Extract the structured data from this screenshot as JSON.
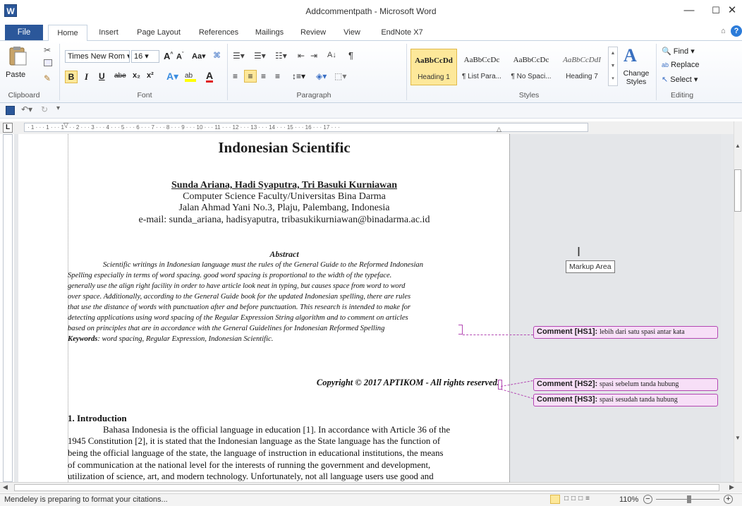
{
  "window": {
    "title": "Addcommentpath - Microsoft Word",
    "app_logo": "W",
    "minimize": "—",
    "maximize": "☐",
    "close": "✕"
  },
  "tabs": [
    {
      "label": "File"
    },
    {
      "label": "Home"
    },
    {
      "label": "Insert"
    },
    {
      "label": "Page Layout"
    },
    {
      "label": "References"
    },
    {
      "label": "Mailings"
    },
    {
      "label": "Review"
    },
    {
      "label": "View"
    },
    {
      "label": "EndNote X7"
    }
  ],
  "ribbon": {
    "clipboard": {
      "paste": "Paste",
      "label": "Clipboard"
    },
    "font": {
      "name": "Times New Rom",
      "size": "16",
      "label": "Font",
      "case": "Aa",
      "bold": "B",
      "italic": "I",
      "underline": "U",
      "strike": "abe",
      "sub": "x₂",
      "sup": "x²"
    },
    "paragraph": {
      "label": "Paragraph",
      "sort": "A↓",
      "pilcrow": "¶"
    },
    "styles": {
      "label": "Styles",
      "items": [
        {
          "preview": "AaBbCcDd",
          "name": "Heading 1"
        },
        {
          "preview": "AaBbCcDc",
          "name": "¶ List Para..."
        },
        {
          "preview": "AaBbCcDc",
          "name": "¶ No Spaci..."
        },
        {
          "preview": "AaBbCcDdI",
          "name": "Heading 7"
        }
      ],
      "change_styles": "Change Styles"
    },
    "editing": {
      "find": "Find",
      "replace": "Replace",
      "select": "Select",
      "label": "Editing"
    }
  },
  "ruler": {
    "marks": "· 1 · · · 1 · · · 1 · · · 2 · · · 3 · · · 4 · · · 5 · · · 6 · · · 7 · · · 8 · · · 9 · · · 10 · · · 11 · · · 12 · · · 13 · · · 14 · · · 15 · · · 16 · · · 17 · · ·"
  },
  "document": {
    "title": "Indonesian Scientific",
    "authors": "Sunda Ariana, Hadi Syaputra, Tri Basuki Kurniawan",
    "affiliation": "Computer Science Faculty/Universitas Bina Darma",
    "address": "Jalan Ahmad Yani No.3, Plaju, Palembang, Indonesia",
    "email": "e-mail: sunda_ariana, hadisyaputra, tribasukikurniawan@binadarma.ac.id",
    "abstract_title": "Abstract",
    "abstract_lines": [
      "Scientific writings in Indonesian language must the rules of the General Guide to the Reformed Indonesian",
      "Spelling especially in terms of word spacing. good word spacing is proportional to the width of the typeface.",
      "generally use the align right facility in order to have article look neat in typing, but causes space from word to word",
      "over space. Additionally, according to the General Guide book for the updated Indonesian spelling, there are rules",
      "that use the distance of words with punctuation after and before punctuation. This research is intended to make for",
      "detecting applications using word spacing of the Regular Expression String algorithm and to comment on articles",
      "based on principles that are in accordance with the General Guidelines for Indonesian Reformed Spelling"
    ],
    "keywords_label": "Keywords",
    "keywords": ": word spacing, Regular Expression, Indonesian Scientific.",
    "copyright": "Copyright © 2017 APTIKOM - All rights reserved.",
    "intro_title": "1. Introduction",
    "intro_lines": [
      "Bahasa Indonesia is the official language in education [1]. In accordance with Article 36 of the",
      "1945 Constitution [2], it is stated that the Indonesian language as the State language has the function of",
      "being the official language of the state, the language of instruction in educational institutions, the means",
      "of communication at the national level for the interests of running the government and development,",
      "utilization of science, art, and modern technology. Unfortunately, not all language users use good and"
    ]
  },
  "markup": {
    "tooltip": "Markup Area"
  },
  "comments": [
    {
      "tag": "Comment [HS1]:",
      "text": "lebih dari satu spasi antar kata"
    },
    {
      "tag": "Comment [HS2]:",
      "text": "spasi sebelum tanda hubung"
    },
    {
      "tag": "Comment [HS3]:",
      "text": "spasi sesudah tanda hubung"
    }
  ],
  "status": {
    "message": "Mendeley is preparing to format your citations...",
    "zoom": "110%"
  }
}
